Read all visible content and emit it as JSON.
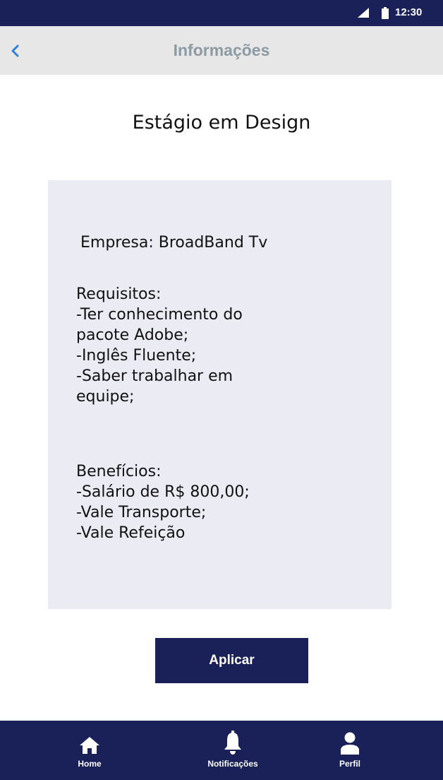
{
  "status_bar": {
    "time": "12:30"
  },
  "app_bar": {
    "title": "Informações",
    "back_icon": "chevron-left-icon"
  },
  "job": {
    "title": "Estágio em Design",
    "company": "Empresa: BroadBand Tv",
    "requirements": {
      "heading": "Requisitos:",
      "items": [
        "-Ter conhecimento do",
        "pacote Adobe;",
        "-Inglês Fluente;",
        "-Saber trabalhar em",
        "equipe;"
      ]
    },
    "benefits": {
      "heading": "Benefícios:",
      "items": [
        "-Salário de R$ 800,00;",
        "-Vale Transporte;",
        "-Vale Refeição"
      ]
    }
  },
  "apply_button": {
    "label": "Aplicar"
  },
  "bottom_nav": {
    "items": [
      {
        "label": "Home",
        "icon": "home-icon"
      },
      {
        "label": "Notificações",
        "icon": "bell-icon"
      },
      {
        "label": "Perfil",
        "icon": "user-icon"
      }
    ]
  },
  "colors": {
    "primary": "#1a2158",
    "app_bar_bg": "#e7e7e7",
    "card_bg": "#ebebf3",
    "title_gray": "#8c9aa4",
    "back_blue": "#2f7fd8"
  }
}
